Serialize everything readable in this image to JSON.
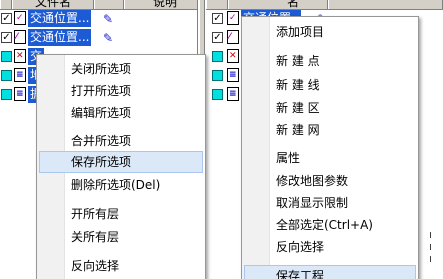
{
  "left_panel": {
    "headers": [
      "",
      "文件名",
      "",
      "说明"
    ],
    "layers": [
      {
        "name": "交通位置...",
        "selected": true,
        "checked": true,
        "icon": "point-layer-icon"
      },
      {
        "name": "交通位置...",
        "selected": true,
        "checked": true,
        "icon": "line-layer-icon"
      },
      {
        "name": "交",
        "selected": true,
        "checked": false,
        "icon": "region-layer-icon"
      },
      {
        "name": "地",
        "selected": true,
        "checked": false,
        "icon": "doc-layer-icon"
      },
      {
        "name": "据",
        "selected": true,
        "checked": false,
        "icon": "doc-layer-icon"
      }
    ]
  },
  "right_panel": {
    "headers": [
      "",
      "名"
    ],
    "layers": [
      {
        "name": "交通位置",
        "selected": true,
        "checked": true,
        "icon": "point-layer-icon"
      },
      {
        "name": "交",
        "selected": true,
        "checked": true,
        "icon": "line-layer-icon"
      },
      {
        "name": "",
        "selected": false,
        "checked": false,
        "icon": "region-layer-icon"
      },
      {
        "name": "",
        "selected": false,
        "checked": false,
        "icon": "doc-layer-icon"
      },
      {
        "name": "",
        "selected": false,
        "checked": false,
        "icon": "doc-layer-icon"
      }
    ]
  },
  "context_menu_left": {
    "items": [
      {
        "label": "关闭所选项"
      },
      {
        "label": "打开所选项"
      },
      {
        "label": "编辑所选项"
      },
      {
        "label": "合并所选项"
      },
      {
        "label": "保存所选项",
        "highlighted": true
      },
      {
        "label": "删除所选项(Del)"
      },
      {
        "label": "开所有层"
      },
      {
        "label": "关所有层"
      },
      {
        "label": "反向选择"
      }
    ]
  },
  "context_menu_right": {
    "items": [
      {
        "label": "添加项目"
      },
      {
        "label": "新 建 点"
      },
      {
        "label": "新 建 线"
      },
      {
        "label": "新 建 区"
      },
      {
        "label": "新 建 网"
      },
      {
        "label": "属性"
      },
      {
        "label": "修改地图参数"
      },
      {
        "label": "取消显示限制"
      },
      {
        "label": "全部选定(Ctrl+A)"
      },
      {
        "label": "反向选择"
      },
      {
        "label": "保存工程"
      }
    ]
  },
  "colors": {
    "selection": "#1c5bd4",
    "menu_highlight": "#dbe8f8",
    "header_bg": "#d4d0c8"
  }
}
